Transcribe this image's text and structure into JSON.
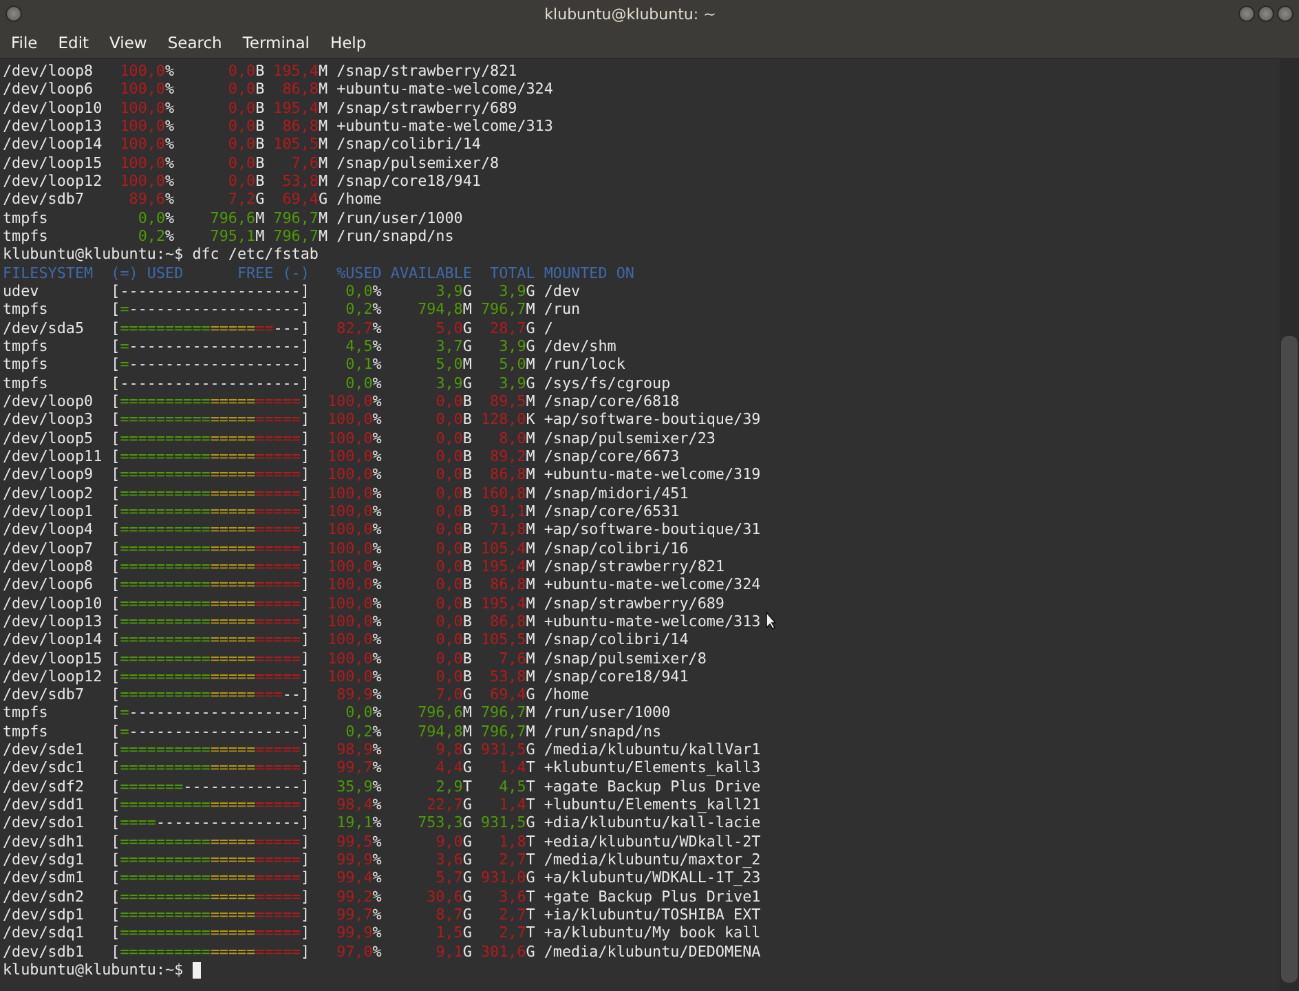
{
  "window": {
    "title": "klubuntu@klubuntu: ~"
  },
  "menu": [
    "File",
    "Edit",
    "View",
    "Search",
    "Terminal",
    "Help"
  ],
  "terminal": {
    "earlier_rows": [
      {
        "fs": "/dev/loop8",
        "pct": "100,0%",
        "avail": "0,0B",
        "total": "195,4M",
        "mount": "/snap/strawberry/821",
        "color": "#b31b1b"
      },
      {
        "fs": "/dev/loop6",
        "pct": "100,0%",
        "avail": "0,0B",
        "total": "86,8M",
        "mount": "+ubuntu-mate-welcome/324",
        "color": "#b31b1b"
      },
      {
        "fs": "/dev/loop10",
        "pct": "100,0%",
        "avail": "0,0B",
        "total": "195,4M",
        "mount": "/snap/strawberry/689",
        "color": "#b31b1b"
      },
      {
        "fs": "/dev/loop13",
        "pct": "100,0%",
        "avail": "0,0B",
        "total": "86,8M",
        "mount": "+ubuntu-mate-welcome/313",
        "color": "#b31b1b"
      },
      {
        "fs": "/dev/loop14",
        "pct": "100,0%",
        "avail": "0,0B",
        "total": "105,5M",
        "mount": "/snap/colibri/14",
        "color": "#b31b1b"
      },
      {
        "fs": "/dev/loop15",
        "pct": "100,0%",
        "avail": "0,0B",
        "total": "7,6M",
        "mount": "/snap/pulsemixer/8",
        "color": "#b31b1b"
      },
      {
        "fs": "/dev/loop12",
        "pct": "100,0%",
        "avail": "0,0B",
        "total": "53,8M",
        "mount": "/snap/core18/941",
        "color": "#b31b1b"
      },
      {
        "fs": "/dev/sdb7",
        "pct": "89,6%",
        "avail": "7,2G",
        "total": "69,4G",
        "mount": "/home",
        "color": "#b31b1b"
      },
      {
        "fs": "tmpfs",
        "pct": "0,0%",
        "avail": "796,6M",
        "total": "796,7M",
        "mount": "/run/user/1000",
        "color": "#4e9a06"
      },
      {
        "fs": "tmpfs",
        "pct": "0,2%",
        "avail": "795,1M",
        "total": "796,7M",
        "mount": "/run/snapd/ns",
        "color": "#4e9a06"
      }
    ],
    "command": {
      "prompt": "klubuntu@klubuntu:~$",
      "text": "dfc /etc/fstab"
    },
    "header": [
      "FILESYSTEM",
      "(=) USED",
      "FREE (-)",
      "%USED",
      "AVAILABLE",
      "TOTAL",
      "MOUNTED ON"
    ],
    "rows": [
      {
        "fs": "udev",
        "bar": {
          "open": "[",
          "free": "--------------------",
          "close": "]"
        },
        "pct": "0,0%",
        "avail": "3,9G",
        "total": "3,9G",
        "mount": "/dev",
        "color": "#4e9a06"
      },
      {
        "fs": "tmpfs",
        "bar": {
          "open": "[",
          "used": "=",
          "free": "-------------------",
          "close": "]"
        },
        "pct": "0,2%",
        "avail": "794,8M",
        "total": "796,7M",
        "mount": "/run",
        "color": "#4e9a06"
      },
      {
        "fs": "/dev/sda5",
        "bar": {
          "open": "[",
          "used": "=================",
          "free": "---",
          "close": "]"
        },
        "pct": "82,7%",
        "avail": "5,0G",
        "total": "28,7G",
        "mount": "/",
        "color": "#b31b1b"
      },
      {
        "fs": "tmpfs",
        "bar": {
          "open": "[",
          "used": "=",
          "free": "-------------------",
          "close": "]"
        },
        "pct": "4,5%",
        "avail": "3,7G",
        "total": "3,9G",
        "mount": "/dev/shm",
        "color": "#4e9a06"
      },
      {
        "fs": "tmpfs",
        "bar": {
          "open": "[",
          "used": "=",
          "free": "-------------------",
          "close": "]"
        },
        "pct": "0,1%",
        "avail": "5,0M",
        "total": "5,0M",
        "mount": "/run/lock",
        "color": "#4e9a06"
      },
      {
        "fs": "tmpfs",
        "bar": {
          "open": "[",
          "free": "--------------------",
          "close": "]"
        },
        "pct": "0,0%",
        "avail": "3,9G",
        "total": "3,9G",
        "mount": "/sys/fs/cgroup",
        "color": "#4e9a06"
      },
      {
        "fs": "/dev/loop0",
        "bar": {
          "open": "[",
          "used": "====================",
          "close": "]"
        },
        "pct": "100,0%",
        "avail": "0,0B",
        "total": "89,5M",
        "mount": "/snap/core/6818",
        "color": "#b31b1b"
      },
      {
        "fs": "/dev/loop3",
        "bar": {
          "open": "[",
          "used": "====================",
          "close": "]"
        },
        "pct": "100,0%",
        "avail": "0,0B",
        "total": "128,0K",
        "mount": "+ap/software-boutique/39",
        "color": "#b31b1b"
      },
      {
        "fs": "/dev/loop5",
        "bar": {
          "open": "[",
          "used": "====================",
          "close": "]"
        },
        "pct": "100,0%",
        "avail": "0,0B",
        "total": "8,0M",
        "mount": "/snap/pulsemixer/23",
        "color": "#b31b1b"
      },
      {
        "fs": "/dev/loop11",
        "bar": {
          "open": "[",
          "used": "====================",
          "close": "]"
        },
        "pct": "100,0%",
        "avail": "0,0B",
        "total": "89,2M",
        "mount": "/snap/core/6673",
        "color": "#b31b1b"
      },
      {
        "fs": "/dev/loop9",
        "bar": {
          "open": "[",
          "used": "====================",
          "close": "]"
        },
        "pct": "100,0%",
        "avail": "0,0B",
        "total": "86,8M",
        "mount": "+ubuntu-mate-welcome/319",
        "color": "#b31b1b"
      },
      {
        "fs": "/dev/loop2",
        "bar": {
          "open": "[",
          "used": "====================",
          "close": "]"
        },
        "pct": "100,0%",
        "avail": "0,0B",
        "total": "160,8M",
        "mount": "/snap/midori/451",
        "color": "#b31b1b"
      },
      {
        "fs": "/dev/loop1",
        "bar": {
          "open": "[",
          "used": "====================",
          "close": "]"
        },
        "pct": "100,0%",
        "avail": "0,0B",
        "total": "91,1M",
        "mount": "/snap/core/6531",
        "color": "#b31b1b"
      },
      {
        "fs": "/dev/loop4",
        "bar": {
          "open": "[",
          "used": "====================",
          "close": "]"
        },
        "pct": "100,0%",
        "avail": "0,0B",
        "total": "71,8M",
        "mount": "+ap/software-boutique/31",
        "color": "#b31b1b"
      },
      {
        "fs": "/dev/loop7",
        "bar": {
          "open": "[",
          "used": "====================",
          "close": "]"
        },
        "pct": "100,0%",
        "avail": "0,0B",
        "total": "105,4M",
        "mount": "/snap/colibri/16",
        "color": "#b31b1b"
      },
      {
        "fs": "/dev/loop8",
        "bar": {
          "open": "[",
          "used": "====================",
          "close": "]"
        },
        "pct": "100,0%",
        "avail": "0,0B",
        "total": "195,4M",
        "mount": "/snap/strawberry/821",
        "color": "#b31b1b"
      },
      {
        "fs": "/dev/loop6",
        "bar": {
          "open": "[",
          "used": "====================",
          "close": "]"
        },
        "pct": "100,0%",
        "avail": "0,0B",
        "total": "86,8M",
        "mount": "+ubuntu-mate-welcome/324",
        "color": "#b31b1b"
      },
      {
        "fs": "/dev/loop10",
        "bar": {
          "open": "[",
          "used": "====================",
          "close": "]"
        },
        "pct": "100,0%",
        "avail": "0,0B",
        "total": "195,4M",
        "mount": "/snap/strawberry/689",
        "color": "#b31b1b"
      },
      {
        "fs": "/dev/loop13",
        "bar": {
          "open": "[",
          "used": "====================",
          "close": "]"
        },
        "pct": "100,0%",
        "avail": "0,0B",
        "total": "86,8M",
        "mount": "+ubuntu-mate-welcome/313",
        "color": "#b31b1b"
      },
      {
        "fs": "/dev/loop14",
        "bar": {
          "open": "[",
          "used": "====================",
          "close": "]"
        },
        "pct": "100,0%",
        "avail": "0,0B",
        "total": "105,5M",
        "mount": "/snap/colibri/14",
        "color": "#b31b1b"
      },
      {
        "fs": "/dev/loop15",
        "bar": {
          "open": "[",
          "used": "====================",
          "close": "]"
        },
        "pct": "100,0%",
        "avail": "0,0B",
        "total": "7,6M",
        "mount": "/snap/pulsemixer/8",
        "color": "#b31b1b"
      },
      {
        "fs": "/dev/loop12",
        "bar": {
          "open": "[",
          "used": "====================",
          "close": "]"
        },
        "pct": "100,0%",
        "avail": "0,0B",
        "total": "53,8M",
        "mount": "/snap/core18/941",
        "color": "#b31b1b"
      },
      {
        "fs": "/dev/sdb7",
        "bar": {
          "open": "[",
          "used": "==================",
          "free": "--",
          "close": "]"
        },
        "pct": "89,9%",
        "avail": "7,0G",
        "total": "69,4G",
        "mount": "/home",
        "color": "#b31b1b"
      },
      {
        "fs": "tmpfs",
        "bar": {
          "open": "[",
          "used": "=",
          "free": "-------------------",
          "close": "]"
        },
        "pct": "0,0%",
        "avail": "796,6M",
        "total": "796,7M",
        "mount": "/run/user/1000",
        "color": "#4e9a06"
      },
      {
        "fs": "tmpfs",
        "bar": {
          "open": "[",
          "used": "=",
          "free": "-------------------",
          "close": "]"
        },
        "pct": "0,2%",
        "avail": "794,8M",
        "total": "796,7M",
        "mount": "/run/snapd/ns",
        "color": "#4e9a06"
      },
      {
        "fs": "/dev/sde1",
        "bar": {
          "open": "[",
          "used": "====================",
          "close": "]"
        },
        "pct": "98,9%",
        "avail": "9,8G",
        "total": "931,5G",
        "mount": "/media/klubuntu/kallVar1",
        "color": "#b31b1b"
      },
      {
        "fs": "/dev/sdc1",
        "bar": {
          "open": "[",
          "used": "====================",
          "close": "]"
        },
        "pct": "99,7%",
        "avail": "4,4G",
        "total": "1,4T",
        "mount": "+klubuntu/Elements_kall3",
        "color": "#b31b1b"
      },
      {
        "fs": "/dev/sdf2",
        "bar": {
          "open": "[",
          "used": "=======",
          "free": "-------------",
          "close": "]"
        },
        "pct": "35,9%",
        "avail": "2,9T",
        "total": "4,5T",
        "mount": "+agate Backup Plus Drive",
        "color": "#4e9a06"
      },
      {
        "fs": "/dev/sdd1",
        "bar": {
          "open": "[",
          "used": "====================",
          "close": "]"
        },
        "pct": "98,4%",
        "avail": "22,7G",
        "total": "1,4T",
        "mount": "+lubuntu/Elements_kall21",
        "color": "#b31b1b"
      },
      {
        "fs": "/dev/sdo1",
        "bar": {
          "open": "[",
          "used": "====",
          "free": "----------------",
          "close": "]"
        },
        "pct": "19,1%",
        "avail": "753,3G",
        "total": "931,5G",
        "mount": "+dia/klubuntu/kall-lacie",
        "color": "#4e9a06"
      },
      {
        "fs": "/dev/sdh1",
        "bar": {
          "open": "[",
          "used": "====================",
          "close": "]"
        },
        "pct": "99,5%",
        "avail": "9,0G",
        "total": "1,8T",
        "mount": "+edia/klubuntu/WDkall-2T",
        "color": "#b31b1b"
      },
      {
        "fs": "/dev/sdg1",
        "bar": {
          "open": "[",
          "used": "====================",
          "close": "]"
        },
        "pct": "99,9%",
        "avail": "3,6G",
        "total": "2,7T",
        "mount": "/media/klubuntu/maxtor_2",
        "color": "#b31b1b"
      },
      {
        "fs": "/dev/sdm1",
        "bar": {
          "open": "[",
          "used": "====================",
          "close": "]"
        },
        "pct": "99,4%",
        "avail": "5,7G",
        "total": "931,0G",
        "mount": "+a/klubuntu/WDKALL-1T_23",
        "color": "#b31b1b"
      },
      {
        "fs": "/dev/sdn2",
        "bar": {
          "open": "[",
          "used": "====================",
          "close": "]"
        },
        "pct": "99,2%",
        "avail": "30,6G",
        "total": "3,6T",
        "mount": "+gate Backup Plus Drive1",
        "color": "#b31b1b"
      },
      {
        "fs": "/dev/sdp1",
        "bar": {
          "open": "[",
          "used": "====================",
          "close": "]"
        },
        "pct": "99,7%",
        "avail": "8,7G",
        "total": "2,7T",
        "mount": "+ia/klubuntu/TOSHIBA EXT",
        "color": "#b31b1b"
      },
      {
        "fs": "/dev/sdq1",
        "bar": {
          "open": "[",
          "used": "====================",
          "close": "]"
        },
        "pct": "99,9%",
        "avail": "1,5G",
        "total": "2,7T",
        "mount": "+a/klubuntu/My book kall",
        "color": "#b31b1b"
      },
      {
        "fs": "/dev/sdb1",
        "bar": {
          "open": "[",
          "used": "====================",
          "close": "]"
        },
        "pct": "97,0%",
        "avail": "9,1G",
        "total": "301,6G",
        "mount": "/media/klubuntu/DEDOMENA",
        "color": "#b31b1b"
      }
    ],
    "final_prompt": "klubuntu@klubuntu:~$"
  }
}
